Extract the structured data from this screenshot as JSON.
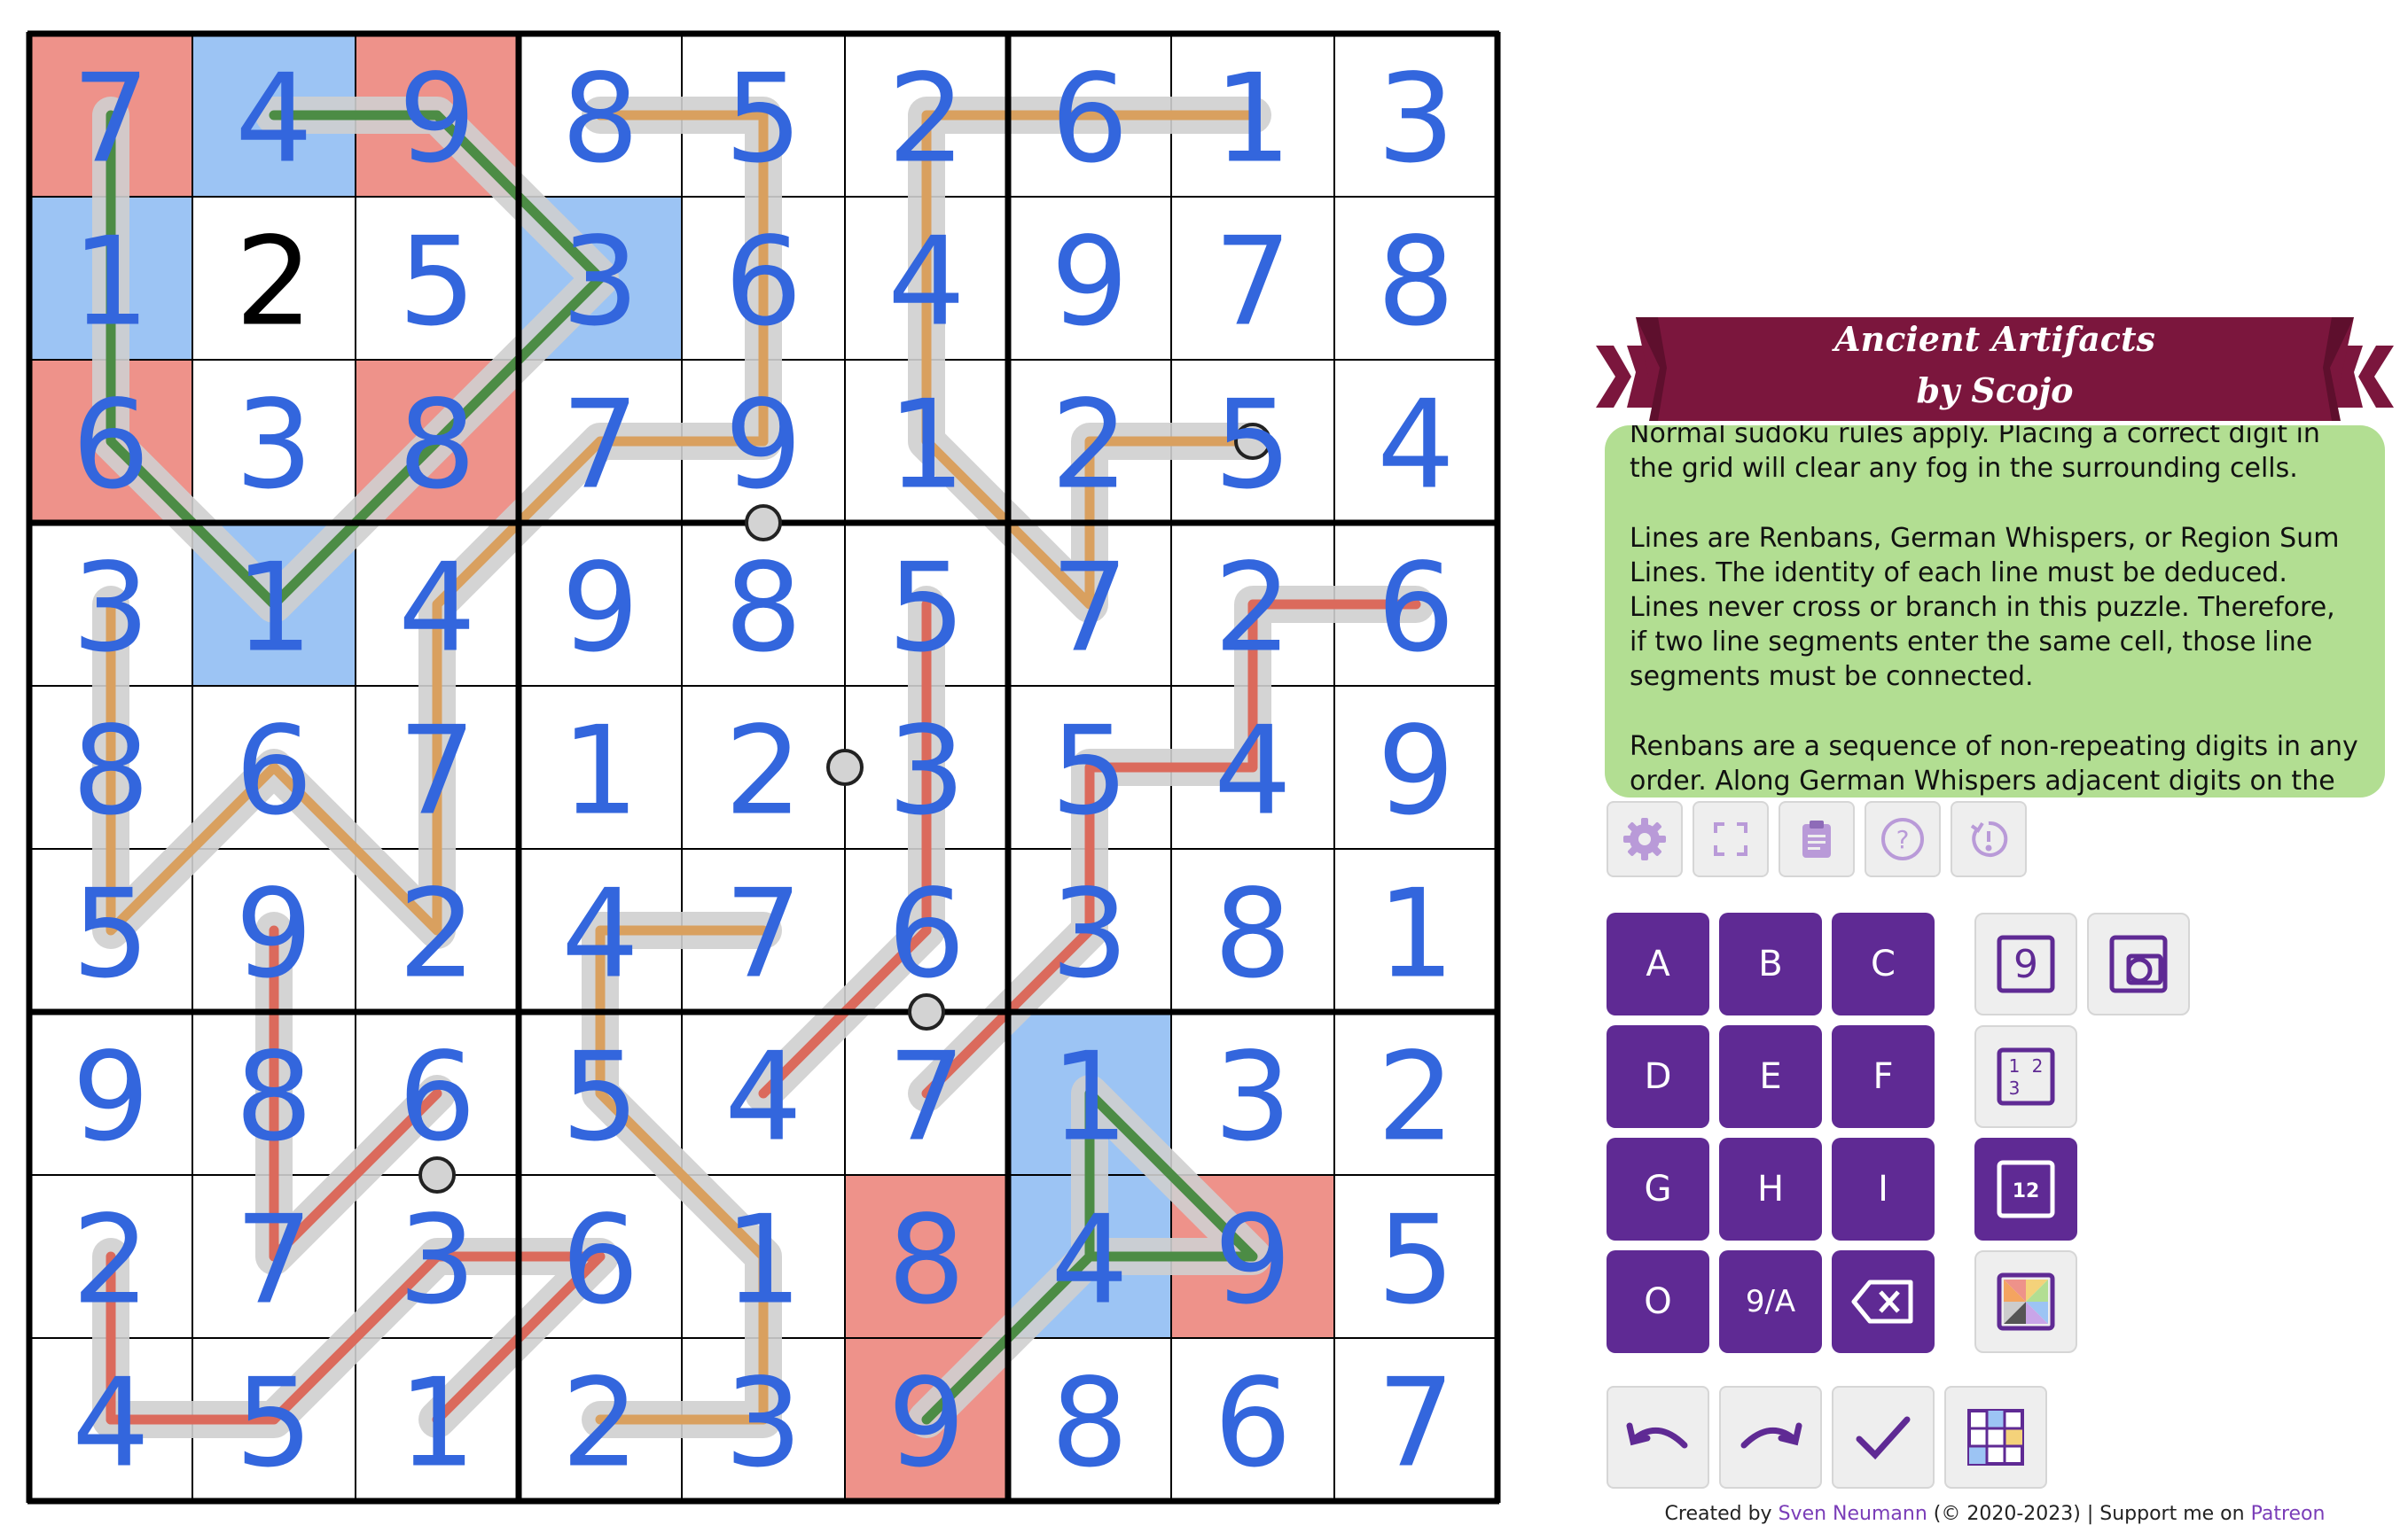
{
  "puzzle": {
    "title_line1": "Ancient Artifacts",
    "title_line2": "by Scojo",
    "rules": [
      "Normal sudoku rules apply. Placing a correct digit in the grid will clear any fog in the surrounding cells.",
      "Lines are Renbans, German Whispers, or Region Sum Lines. The identity of each line must be deduced. Lines never cross or branch in this puzzle. Therefore, if two line segments enter the same cell, those line segments must be connected.",
      "Renbans are a sequence of non-repeating digits in any order. Along German Whispers adjacent digits on the line"
    ]
  },
  "grid": {
    "rows": [
      [
        7,
        4,
        9,
        8,
        5,
        2,
        6,
        1,
        3
      ],
      [
        1,
        2,
        5,
        3,
        6,
        4,
        9,
        7,
        8
      ],
      [
        6,
        3,
        8,
        7,
        9,
        1,
        2,
        5,
        4
      ],
      [
        3,
        1,
        4,
        9,
        8,
        5,
        7,
        2,
        6
      ],
      [
        8,
        6,
        7,
        1,
        2,
        3,
        5,
        4,
        9
      ],
      [
        5,
        9,
        2,
        4,
        7,
        6,
        3,
        8,
        1
      ],
      [
        9,
        8,
        6,
        5,
        4,
        7,
        1,
        3,
        2
      ],
      [
        2,
        7,
        3,
        6,
        1,
        8,
        4,
        9,
        5
      ],
      [
        4,
        5,
        1,
        2,
        3,
        9,
        8,
        6,
        7
      ]
    ],
    "given_cells": [
      [
        1,
        1
      ]
    ],
    "shaded_red": [
      [
        0,
        0
      ],
      [
        0,
        2
      ],
      [
        2,
        0
      ],
      [
        2,
        2
      ],
      [
        7,
        5
      ],
      [
        8,
        5
      ],
      [
        7,
        7
      ]
    ],
    "shaded_blue": [
      [
        0,
        1
      ],
      [
        1,
        0
      ],
      [
        1,
        3
      ],
      [
        3,
        1
      ],
      [
        6,
        6
      ],
      [
        7,
        6
      ]
    ],
    "lines": [
      {
        "color": "#d9a05f",
        "cells": [
          [
            0,
            3
          ],
          [
            0,
            4
          ],
          [
            1,
            4
          ],
          [
            2,
            4
          ],
          [
            2,
            3
          ],
          [
            3,
            2
          ],
          [
            4,
            2
          ],
          [
            5,
            2
          ],
          [
            4,
            1
          ],
          [
            5,
            0
          ],
          [
            4,
            0
          ],
          [
            3,
            0
          ]
        ]
      },
      {
        "color": "#d9a05f",
        "cells": [
          [
            0,
            7
          ],
          [
            0,
            6
          ],
          [
            0,
            5
          ],
          [
            1,
            5
          ],
          [
            2,
            5
          ],
          [
            3,
            6
          ],
          [
            2,
            6
          ],
          [
            2,
            7
          ]
        ]
      },
      {
        "color": "#d9a05f",
        "cells": [
          [
            5,
            4
          ],
          [
            5,
            3
          ],
          [
            6,
            3
          ],
          [
            7,
            4
          ],
          [
            8,
            4
          ],
          [
            8,
            3
          ]
        ]
      },
      {
        "color": "#db6a5c",
        "cells": [
          [
            3,
            8
          ],
          [
            3,
            7
          ],
          [
            4,
            7
          ],
          [
            4,
            6
          ],
          [
            5,
            6
          ],
          [
            6,
            5
          ]
        ]
      },
      {
        "color": "#db6a5c",
        "cells": [
          [
            3,
            5
          ],
          [
            4,
            5
          ],
          [
            5,
            5
          ],
          [
            6,
            4
          ]
        ]
      },
      {
        "color": "#db6a5c",
        "cells": [
          [
            5,
            1
          ],
          [
            6,
            1
          ],
          [
            7,
            1
          ],
          [
            6,
            2
          ]
        ]
      },
      {
        "color": "#db6a5c",
        "cells": [
          [
            8,
            0
          ],
          [
            8,
            1
          ],
          [
            7,
            2
          ],
          [
            7,
            3
          ],
          [
            8,
            2
          ]
        ]
      },
      {
        "color": "#db6a5c",
        "cells": [
          [
            7,
            0
          ],
          [
            8,
            0
          ]
        ]
      },
      {
        "color": "#4c8c45",
        "cells": [
          [
            0,
            1
          ],
          [
            0,
            2
          ],
          [
            1,
            3
          ],
          [
            2,
            2
          ],
          [
            3,
            1
          ],
          [
            2,
            0
          ],
          [
            1,
            0
          ],
          [
            0,
            0
          ]
        ]
      },
      {
        "color": "#4c8c45",
        "cells": [
          [
            8,
            5
          ],
          [
            7,
            6
          ],
          [
            6,
            6
          ],
          [
            7,
            7
          ],
          [
            7,
            6
          ]
        ]
      }
    ],
    "dots": [
      [
        2.5,
        7.5
      ],
      [
        3.0,
        4.5
      ],
      [
        4.5,
        5.0
      ],
      [
        6.0,
        5.5
      ],
      [
        7.0,
        2.5
      ]
    ],
    "colors": {
      "digit_blue": "#3366dd",
      "digit_given": "#000000",
      "red_shade": "#ee928a",
      "blue_shade": "#9cc4f4",
      "line_halo": "#cfcfcf"
    }
  },
  "toolbar": {
    "icons": [
      "gear-icon",
      "fullscreen-icon",
      "clipboard-icon",
      "help-icon",
      "restart-icon"
    ]
  },
  "keypad": {
    "keys": [
      "A",
      "B",
      "C",
      "D",
      "E",
      "F",
      "G",
      "H",
      "I",
      "O"
    ],
    "toggle_label": "9/A"
  },
  "modes": {
    "normal_digit": "9",
    "corner_digits": "1 2 3",
    "center_digits": "12"
  },
  "footer": {
    "prefix": "Created by ",
    "author": "Sven Neumann",
    "middle": " (© 2020-2023) | Support me on ",
    "support": "Patreon"
  },
  "theme": {
    "accent": "#5f2a94",
    "banner": "#7b163d",
    "rules_bg": "#b2de92"
  }
}
